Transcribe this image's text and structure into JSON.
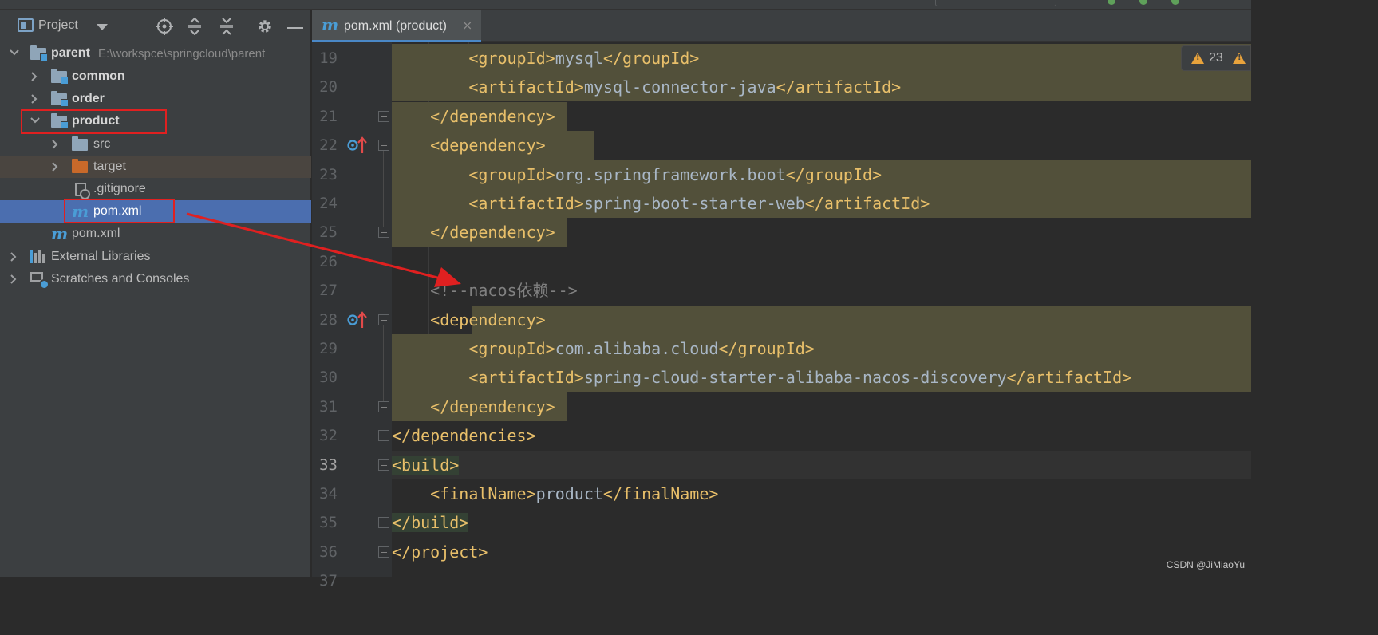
{
  "project_panel": {
    "title": "Project",
    "tree": [
      {
        "label": "parent",
        "path": "E:\\workspce\\springcloud\\parent"
      },
      {
        "label": "common"
      },
      {
        "label": "order"
      },
      {
        "label": "product"
      },
      {
        "label": "src"
      },
      {
        "label": "target"
      },
      {
        "label": ".gitignore"
      },
      {
        "label": "pom.xml"
      },
      {
        "label": "pom.xml"
      },
      {
        "label": "External Libraries"
      },
      {
        "label": "Scratches and Consoles"
      }
    ]
  },
  "editor": {
    "tab": {
      "icon_letter": "m",
      "label": "pom.xml (product)",
      "close": "×"
    },
    "warnings_count": "23",
    "current_line": "33",
    "lines": [
      {
        "no": "19",
        "indent": "        ",
        "content": "<groupId>mysql</groupId>"
      },
      {
        "no": "20",
        "indent": "        ",
        "content": "<artifactId>mysql-connector-java</artifactId>"
      },
      {
        "no": "21",
        "indent": "    ",
        "content": "</dependency>"
      },
      {
        "no": "22",
        "indent": "    ",
        "content": "<dependency>"
      },
      {
        "no": "23",
        "indent": "        ",
        "content": "<groupId>org.springframework.boot</groupId>"
      },
      {
        "no": "24",
        "indent": "        ",
        "content": "<artifactId>spring-boot-starter-web</artifactId>"
      },
      {
        "no": "25",
        "indent": "    ",
        "content": "</dependency>"
      },
      {
        "no": "26",
        "indent": "",
        "content": ""
      },
      {
        "no": "27",
        "indent": "    ",
        "content": "<!--nacos依赖-->"
      },
      {
        "no": "28",
        "indent": "    ",
        "content": "<dependency>"
      },
      {
        "no": "29",
        "indent": "        ",
        "content": "<groupId>com.alibaba.cloud</groupId>"
      },
      {
        "no": "30",
        "indent": "        ",
        "content": "<artifactId>spring-cloud-starter-alibaba-nacos-discovery</artifactId>"
      },
      {
        "no": "31",
        "indent": "    ",
        "content": "</dependency>"
      },
      {
        "no": "32",
        "indent": "",
        "content": "</dependencies>"
      },
      {
        "no": "33",
        "indent": "",
        "content": "<build>"
      },
      {
        "no": "34",
        "indent": "    ",
        "content": "<finalName>product</finalName>"
      },
      {
        "no": "35",
        "indent": "",
        "content": "</build>"
      },
      {
        "no": "36",
        "indent": "",
        "content": "</project>"
      },
      {
        "no": "37",
        "indent": "",
        "content": ""
      }
    ]
  },
  "watermark": "CSDN @JiMiaoYu",
  "colors": {
    "tag": "#e8bf6a",
    "text": "#a9b7c6",
    "comment": "#808080",
    "highlight_band": "#52503a",
    "selection": "#4b6eaf",
    "annotation_red": "#e02020"
  },
  "icons": [
    "project-view-icon",
    "dropdown-arrow-icon",
    "locate-icon",
    "expand-all-icon",
    "collapse-all-icon",
    "gear-icon",
    "minimize-icon",
    "folder-icon",
    "maven-m-icon",
    "gitignore-icon",
    "libraries-icon",
    "scratches-icon",
    "implementation-marker-icon",
    "fold-marker-icon",
    "lightbulb-icon",
    "warning-icon",
    "close-icon",
    "chevron-right-icon",
    "chevron-down-icon"
  ]
}
